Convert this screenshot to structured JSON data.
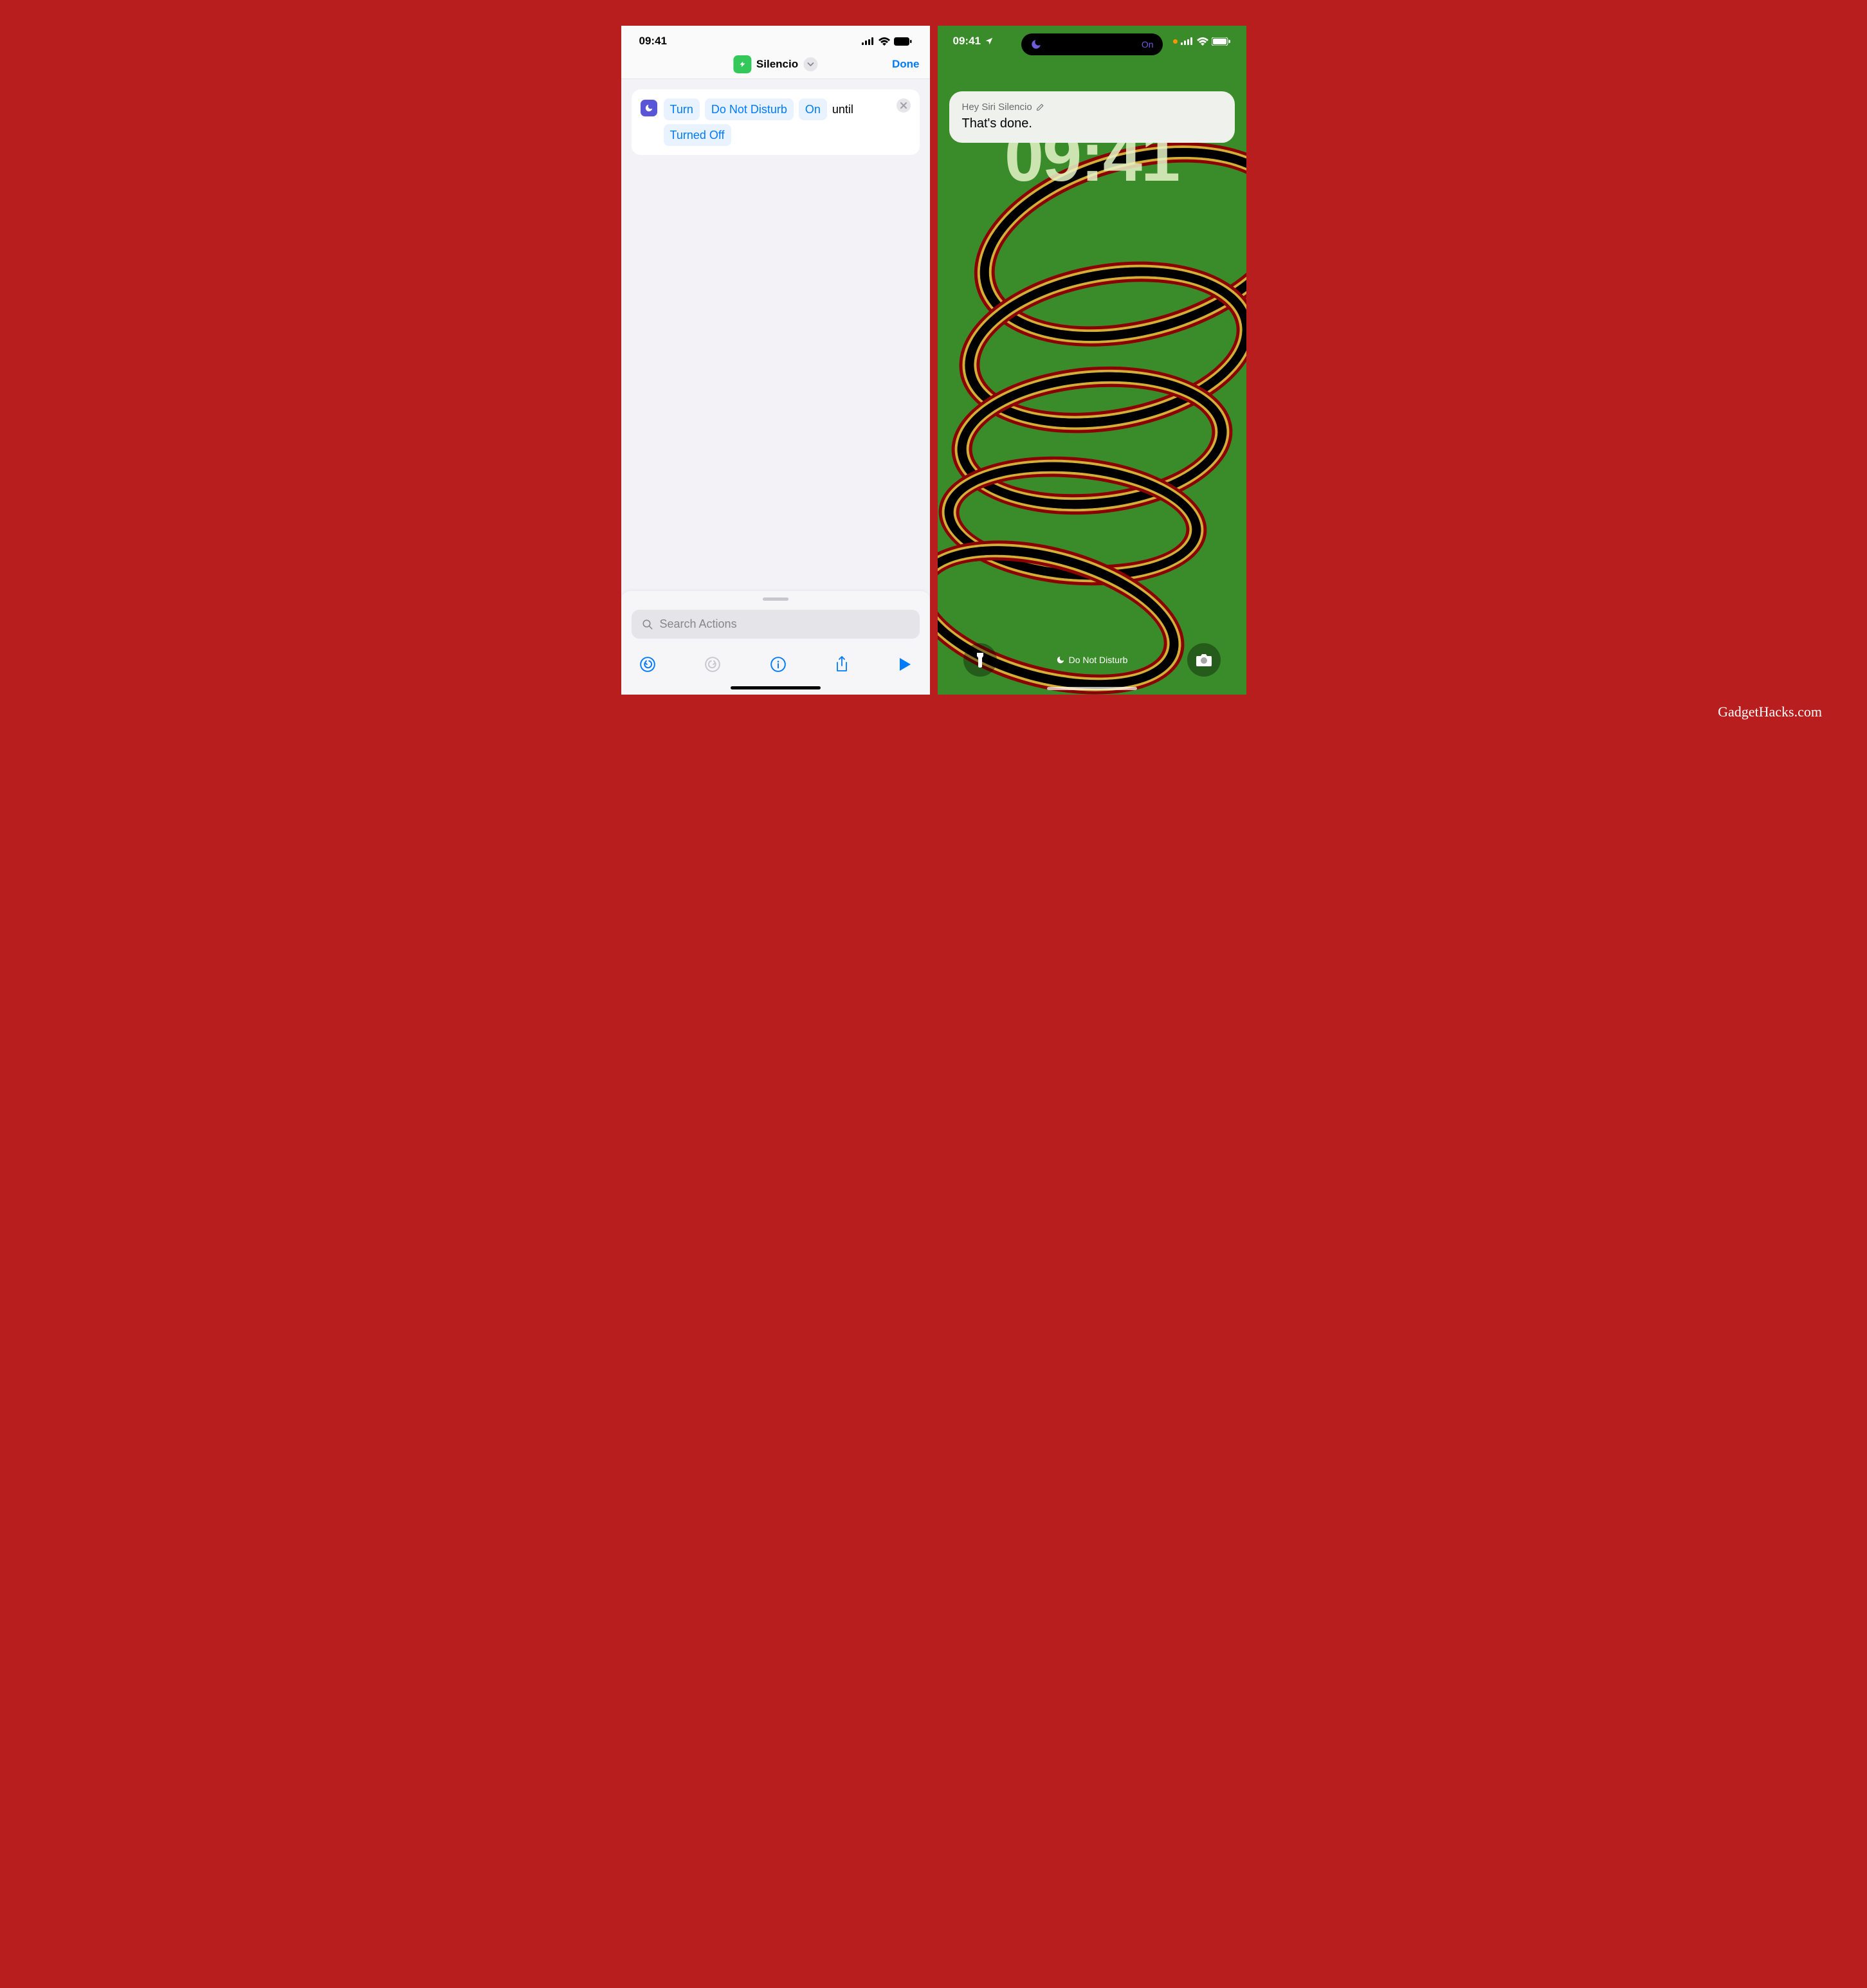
{
  "left": {
    "status_time": "09:41",
    "nav": {
      "title": "Silencio",
      "done": "Done"
    },
    "action": {
      "tokens": [
        "Turn",
        "Do Not Disturb",
        "On"
      ],
      "plain1": "until",
      "tokens2": [
        "Turned Off"
      ]
    },
    "search_placeholder": "Search Actions"
  },
  "right": {
    "status_time": "09:41",
    "island_label": "On",
    "siri_header": "Hey Siri Silencio",
    "siri_body": "That's done.",
    "big_time": "09:41",
    "focus_label": "Do Not Disturb"
  },
  "watermark": "GadgetHacks.com"
}
